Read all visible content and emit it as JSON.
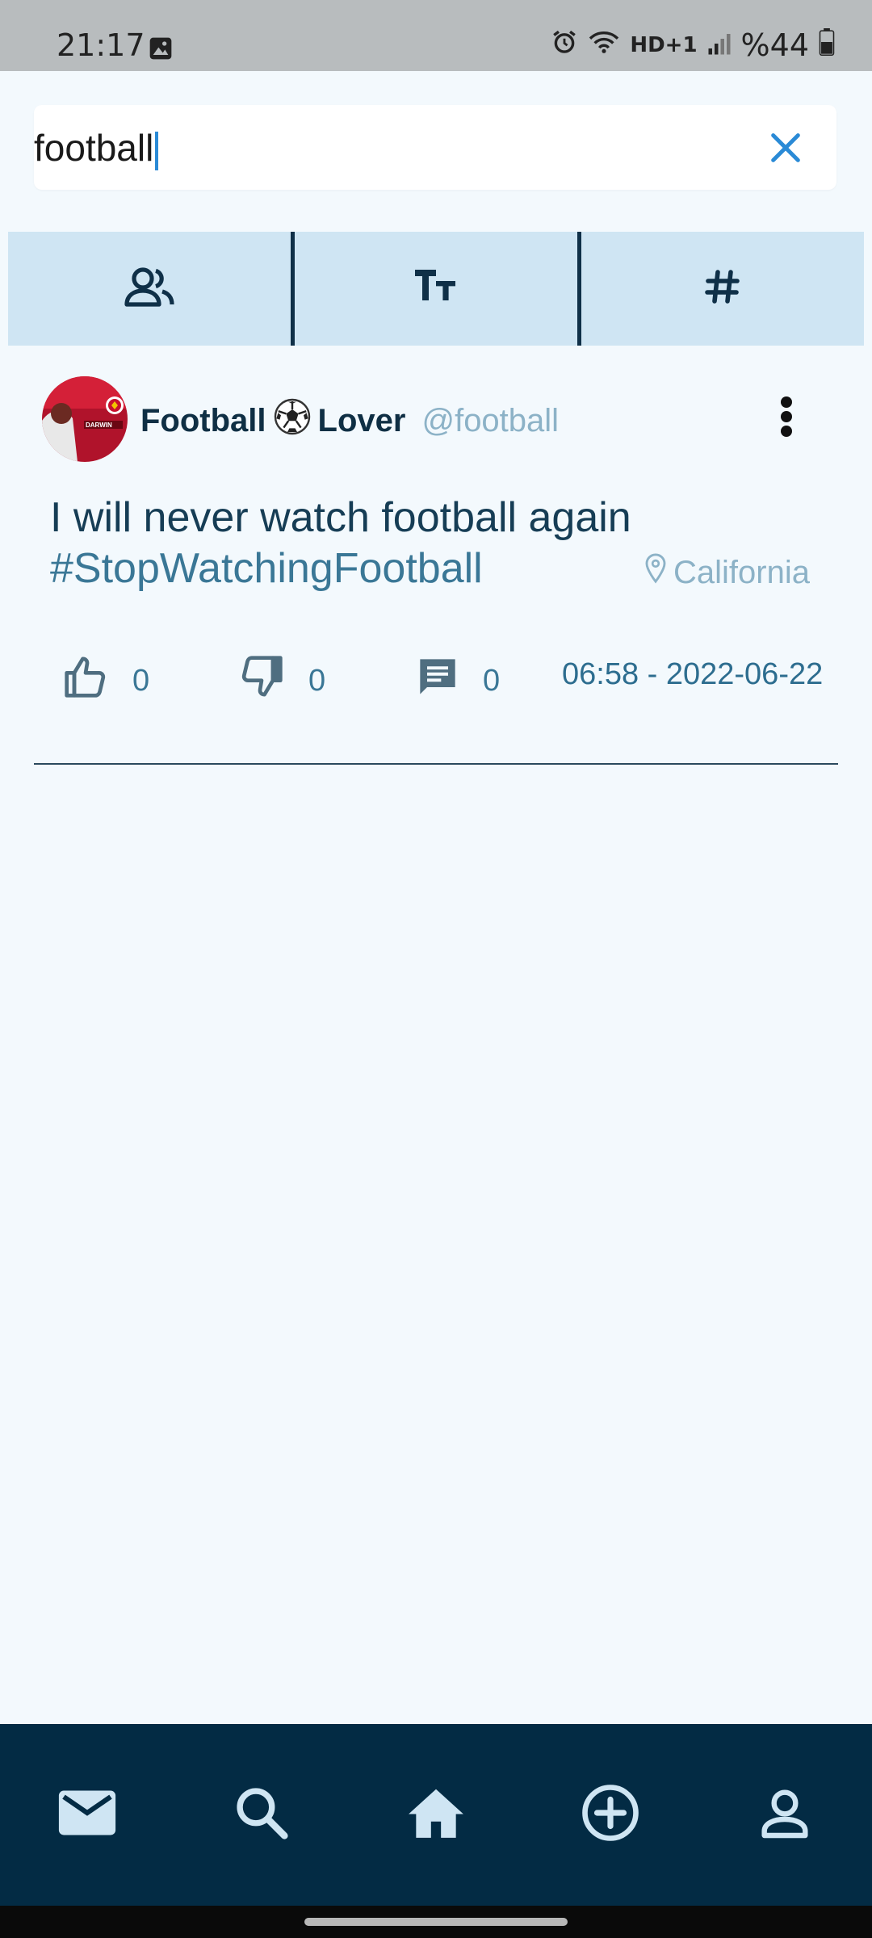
{
  "status_bar": {
    "time": "21:17",
    "battery": "%44",
    "icons": [
      "gallery-icon",
      "alarm-icon",
      "wifi-icon",
      "hd-plus-icon",
      "signal-icon",
      "battery-icon"
    ],
    "hd_label": "HD+1"
  },
  "search": {
    "value": "football",
    "clear_icon": "close-icon"
  },
  "tabs": [
    {
      "name": "users",
      "icon": "people-icon"
    },
    {
      "name": "text",
      "icon": "text-size-icon",
      "glyph": "Tт"
    },
    {
      "name": "hashtags",
      "icon": "hash-icon",
      "glyph": "#"
    }
  ],
  "post": {
    "display_name_part1": "Football",
    "emoji": "⚽",
    "display_name_part2": "Lover",
    "handle": "@football",
    "text": "I will never watch football again",
    "hashtag": "#StopWatchingFootball",
    "location": "California",
    "likes": "0",
    "dislikes": "0",
    "comments": "0",
    "timestamp": "06:58 - 2022-06-22"
  },
  "bottom_nav": [
    {
      "name": "messages",
      "icon": "mail-icon"
    },
    {
      "name": "search",
      "icon": "search-icon"
    },
    {
      "name": "home",
      "icon": "home-icon"
    },
    {
      "name": "add",
      "icon": "add-circle-icon"
    },
    {
      "name": "profile",
      "icon": "person-icon"
    }
  ],
  "colors": {
    "accent": "#2a8ad6",
    "primary_dark": "#032b44",
    "tab_bg": "#cfe5f3",
    "page_bg": "#f3f9fd",
    "muted_text": "#8cb2c7",
    "link": "#3a7796"
  }
}
